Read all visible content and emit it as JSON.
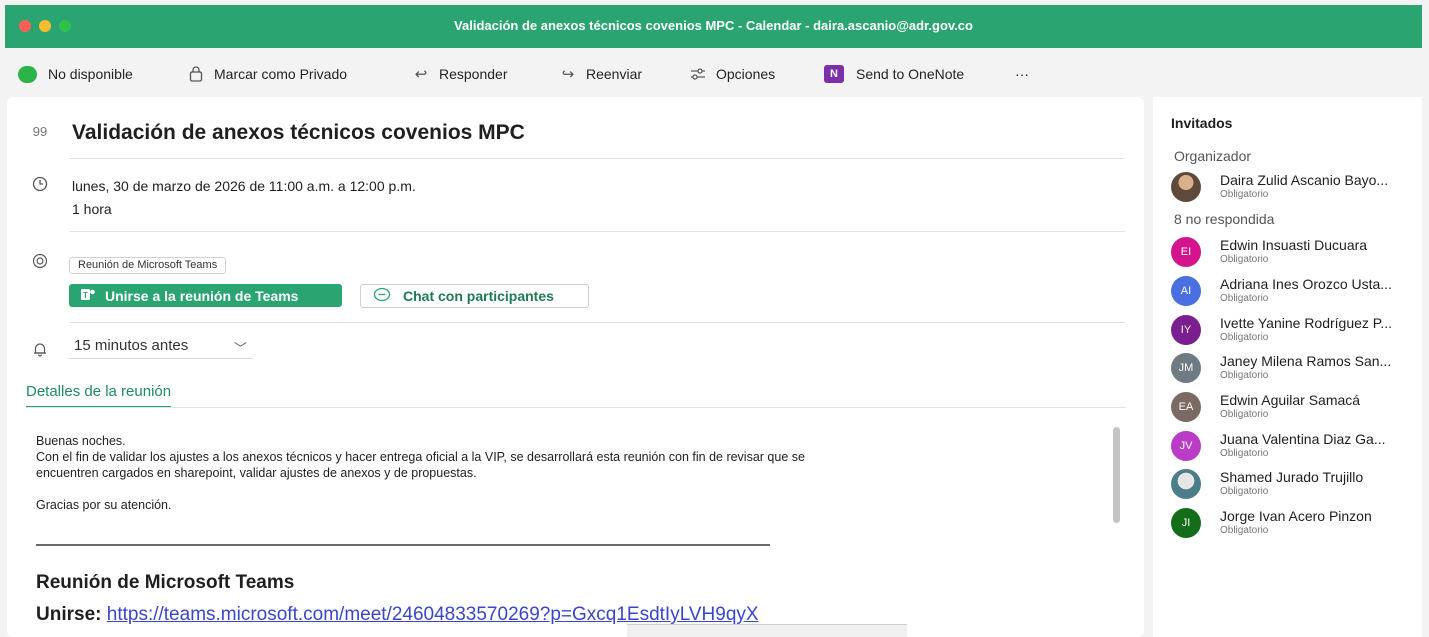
{
  "window": {
    "title": "Validación de anexos técnicos covenios MPC - Calendar - daira.ascanio@adr.gov.co"
  },
  "toolbar": {
    "status_label": "No disponible",
    "private_label": "Marcar como Privado",
    "reply_label": "Responder",
    "forward_label": "Reenviar",
    "options_label": "Opciones",
    "onenote_label": "Send to OneNote",
    "more_label": "···"
  },
  "meeting": {
    "subject": "Validación de anexos técnicos covenios MPC",
    "datetime": "lunes, 30 de marzo de 2026 de 11:00 a.m. a 12:00 p.m.",
    "duration": "1 hora",
    "location_tag": "Reunión de Microsoft Teams",
    "join_button": "Unirse a la reunión de Teams",
    "chat_button": "Chat con participantes",
    "reminder": "15 minutos antes",
    "details_tab": "Detalles de la reunión"
  },
  "body": {
    "greeting": "Buenas noches.",
    "paragraph": "Con el fin de validar los ajustes a los anexos técnicos y hacer entrega oficial a la VIP, se desarrollará esta reunión con fin de revisar que se\nencuentren cargados en sharepoint, validar ajustes de anexos y de propuestas.",
    "closing": "Gracias por su atención.",
    "teams_heading": "Reunión de Microsoft Teams",
    "join_label": "Unirse:",
    "join_link": "https://teams.microsoft.com/meet/24604833570269?p=Gxcq1EsdtIyLVH9qyX"
  },
  "attendees": {
    "title": "Invitados",
    "organizer_group": "Organizador",
    "organizer": {
      "name": "Daira Zulid Ascanio Bayo...",
      "role": "Obligatorio"
    },
    "pending_group": "8 no respondida",
    "people": [
      {
        "initials": "EI",
        "name": "Edwin Insuasti Ducuara",
        "role": "Obligatorio",
        "color": "#d4148c"
      },
      {
        "initials": "AI",
        "name": "Adriana Ines Orozco Usta...",
        "role": "Obligatorio",
        "color": "#4a6fe0"
      },
      {
        "initials": "IY",
        "name": "Ivette Yanine Rodríguez P...",
        "role": "Obligatorio",
        "color": "#7b1e8f"
      },
      {
        "initials": "JM",
        "name": "Janey Milena Ramos San...",
        "role": "Obligatorio",
        "color": "#6f7a83"
      },
      {
        "initials": "EA",
        "name": "Edwin Aguilar Samacá",
        "role": "Obligatorio",
        "color": "#7a6a63"
      },
      {
        "initials": "JV",
        "name": "Juana Valentina Diaz Ga...",
        "role": "Obligatorio",
        "color": "#b93bc6"
      },
      {
        "initials": "",
        "name": "Shamed Jurado Trujillo",
        "role": "Obligatorio",
        "color": "#4b7e8a"
      },
      {
        "initials": "JI",
        "name": "Jorge Ivan Acero Pinzon",
        "role": "Obligatorio",
        "color": "#136d19"
      }
    ]
  }
}
